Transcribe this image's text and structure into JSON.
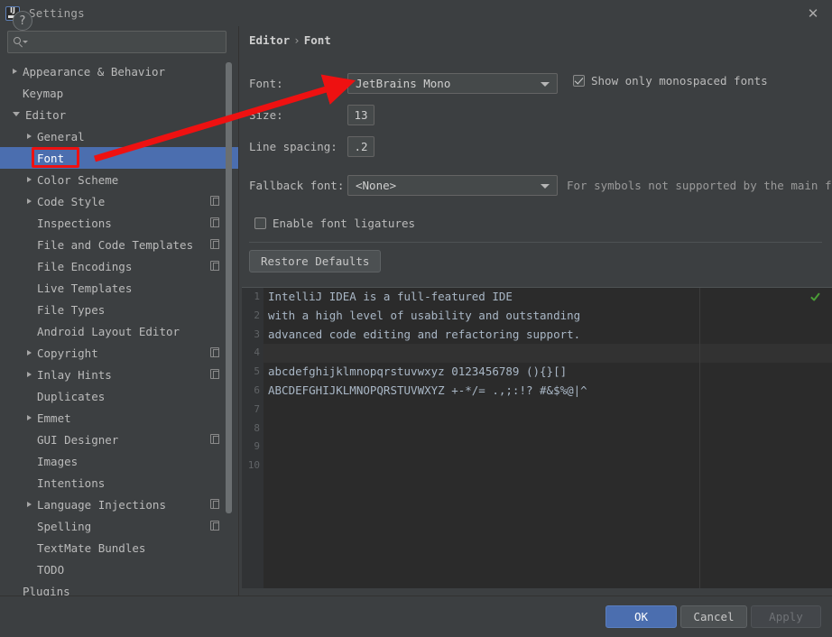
{
  "window": {
    "title": "Settings",
    "logo_icon": "intellij-idea-logo",
    "close_icon": "close-icon"
  },
  "sidebar": {
    "search": {
      "placeholder": "",
      "value": "",
      "icon": "search-icon"
    },
    "items": [
      {
        "label": "Appearance & Behavior",
        "indent": 0,
        "arrow": "right",
        "badge": false,
        "selected": false
      },
      {
        "label": "Keymap",
        "indent": 0,
        "arrow": "none",
        "badge": false,
        "selected": false
      },
      {
        "label": "Editor",
        "indent": 0,
        "arrow": "down",
        "badge": false,
        "selected": false
      },
      {
        "label": "General",
        "indent": 1,
        "arrow": "right",
        "badge": false,
        "selected": false
      },
      {
        "label": "Font",
        "indent": 1,
        "arrow": "none",
        "badge": false,
        "selected": true
      },
      {
        "label": "Color Scheme",
        "indent": 1,
        "arrow": "right",
        "badge": false,
        "selected": false
      },
      {
        "label": "Code Style",
        "indent": 1,
        "arrow": "right",
        "badge": true,
        "selected": false
      },
      {
        "label": "Inspections",
        "indent": 1,
        "arrow": "none",
        "badge": true,
        "selected": false
      },
      {
        "label": "File and Code Templates",
        "indent": 1,
        "arrow": "none",
        "badge": true,
        "selected": false
      },
      {
        "label": "File Encodings",
        "indent": 1,
        "arrow": "none",
        "badge": true,
        "selected": false
      },
      {
        "label": "Live Templates",
        "indent": 1,
        "arrow": "none",
        "badge": false,
        "selected": false
      },
      {
        "label": "File Types",
        "indent": 1,
        "arrow": "none",
        "badge": false,
        "selected": false
      },
      {
        "label": "Android Layout Editor",
        "indent": 1,
        "arrow": "none",
        "badge": false,
        "selected": false
      },
      {
        "label": "Copyright",
        "indent": 1,
        "arrow": "right",
        "badge": true,
        "selected": false
      },
      {
        "label": "Inlay Hints",
        "indent": 1,
        "arrow": "right",
        "badge": true,
        "selected": false
      },
      {
        "label": "Duplicates",
        "indent": 1,
        "arrow": "none",
        "badge": false,
        "selected": false
      },
      {
        "label": "Emmet",
        "indent": 1,
        "arrow": "right",
        "badge": false,
        "selected": false
      },
      {
        "label": "GUI Designer",
        "indent": 1,
        "arrow": "none",
        "badge": true,
        "selected": false
      },
      {
        "label": "Images",
        "indent": 1,
        "arrow": "none",
        "badge": false,
        "selected": false
      },
      {
        "label": "Intentions",
        "indent": 1,
        "arrow": "none",
        "badge": false,
        "selected": false
      },
      {
        "label": "Language Injections",
        "indent": 1,
        "arrow": "right",
        "badge": true,
        "selected": false
      },
      {
        "label": "Spelling",
        "indent": 1,
        "arrow": "none",
        "badge": true,
        "selected": false
      },
      {
        "label": "TextMate Bundles",
        "indent": 1,
        "arrow": "none",
        "badge": false,
        "selected": false
      },
      {
        "label": "TODO",
        "indent": 1,
        "arrow": "none",
        "badge": false,
        "selected": false
      },
      {
        "label": "Plugins",
        "indent": 0,
        "arrow": "none",
        "badge": false,
        "selected": false
      }
    ]
  },
  "main": {
    "breadcrumb": {
      "root": "Editor",
      "separator": "›",
      "leaf": "Font"
    },
    "font_row": {
      "label": "Font:",
      "value": "JetBrains Mono",
      "chevron_icon": "chevron-down-icon"
    },
    "monospaced_checkbox": {
      "label": "Show only monospaced fonts",
      "checked": true
    },
    "size_row": {
      "label": "Size:",
      "value": "13"
    },
    "line_spacing_row": {
      "label": "Line spacing:",
      "value": ".2"
    },
    "fallback_row": {
      "label": "Fallback font:",
      "value": "<None>",
      "chevron_icon": "chevron-down-icon"
    },
    "fallback_hint": "For symbols not supported by the main fo",
    "ligatures_checkbox": {
      "label": "Enable font ligatures",
      "checked": false
    },
    "restore_defaults": "Restore Defaults"
  },
  "preview": {
    "validation_icon": "green-checkmark-icon",
    "line_numbers": [
      "1",
      "2",
      "3",
      "4",
      "5",
      "6",
      "7",
      "8",
      "9",
      "10"
    ],
    "lines": [
      "IntelliJ IDEA is a full-featured IDE",
      "with a high level of usability and outstanding",
      "advanced code editing and refactoring support.",
      "",
      "abcdefghijklmnopqrstuvwxyz 0123456789 (){}[]",
      "ABCDEFGHIJKLMNOPQRSTUVWXYZ +-*/= .,;:!? #&$%@|^",
      "",
      "",
      "",
      ""
    ]
  },
  "footer": {
    "help_label": "?",
    "ok": "OK",
    "cancel": "Cancel",
    "apply": "Apply"
  },
  "annotations": {
    "highlight_color": "#ee1111",
    "box_target": "Font",
    "arrow_points_to": "font-combo"
  }
}
